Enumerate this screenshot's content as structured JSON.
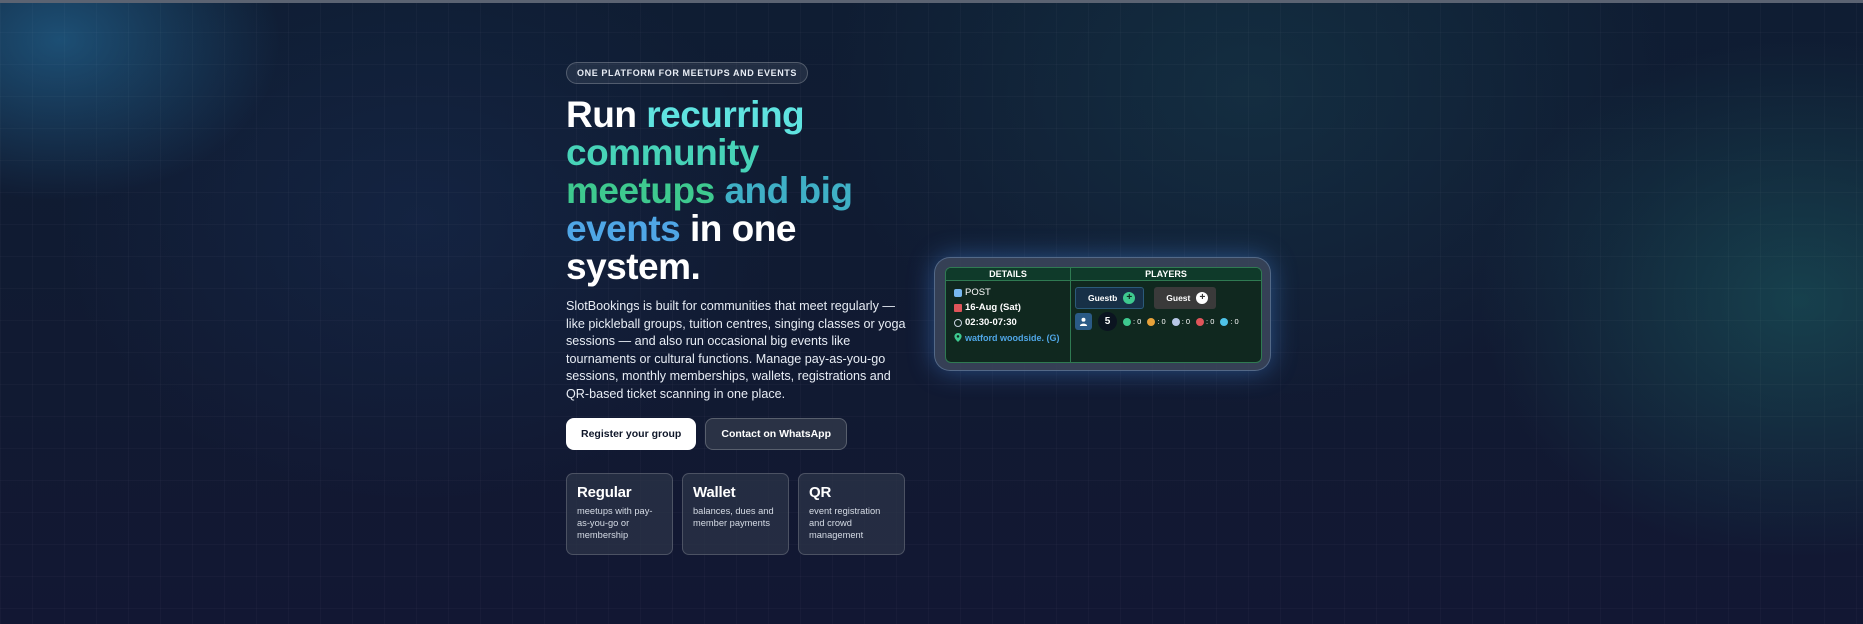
{
  "badge": "ONE PLATFORM FOR MEETUPS AND EVENTS",
  "headline": {
    "w1": "Run",
    "w2": "recurring",
    "w3": "community",
    "w4": "meetups",
    "w5": "and big",
    "w6": "events",
    "w7": "in one",
    "w8": "system."
  },
  "description": "SlotBookings is built for communities that meet regularly — like pickleball groups, tuition centres, singing classes or yoga sessions — and also run occasional big events like tournaments or cultural functions. Manage pay-as-you-go sessions, monthly memberships, wallets, registrations and QR-based ticket scanning in one place.",
  "buttons": {
    "register": "Register your group",
    "whatsapp": "Contact on WhatsApp"
  },
  "features": [
    {
      "title": "Regular",
      "subtitle": "meetups with pay-as-you-go or membership"
    },
    {
      "title": "Wallet",
      "subtitle": "balances, dues and member payments"
    },
    {
      "title": "QR",
      "subtitle": "event registration and crowd management"
    }
  ],
  "widget": {
    "details_header": "DETAILS",
    "players_header": "PLAYERS",
    "type": "POST",
    "date": "16-Aug (Sat)",
    "time": "02:30-07:30",
    "location": "watford woodside. (G)",
    "guest1": "Guestb",
    "guest2": "Guest",
    "count": "5",
    "stats": {
      "confirmed": ": 0",
      "pending": ": 0",
      "group": ": 0",
      "cancelled": ": 0",
      "other": ": 0"
    }
  },
  "colors": {
    "accent_cyan": "#5fe3e0",
    "accent_green": "#3ec98f",
    "accent_blue": "#4fa6e6",
    "background": "#0f1a30"
  }
}
